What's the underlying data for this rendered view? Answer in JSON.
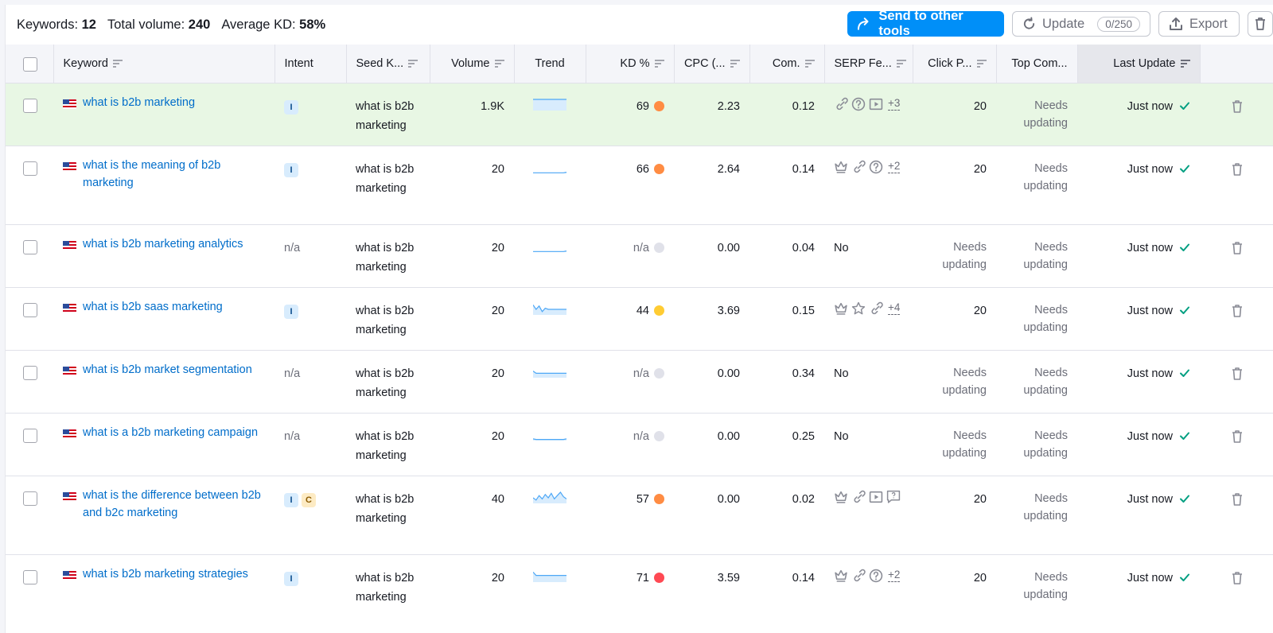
{
  "summary": {
    "keywords_label": "Keywords:",
    "keywords_value": "12",
    "volume_label": "Total volume:",
    "volume_value": "240",
    "kd_label": "Average KD:",
    "kd_value": "58%"
  },
  "toolbar": {
    "send_label": "Send to other tools",
    "update_label": "Update",
    "update_counter": "0/250",
    "export_label": "Export"
  },
  "columns": {
    "keyword": "Keyword",
    "intent": "Intent",
    "seed": "Seed K...",
    "volume": "Volume",
    "trend": "Trend",
    "kd": "KD %",
    "cpc": "CPC (...",
    "com": "Com.",
    "serp": "SERP Fe...",
    "click": "Click P...",
    "top": "Top Com...",
    "last": "Last Update"
  },
  "colors": {
    "accent": "#008ff8",
    "link": "#006dca",
    "kd_orange": "#ff8c43",
    "kd_yellow": "#ffcc33",
    "kd_red": "#ff4953",
    "kd_na": "#e0e1e9",
    "highlight_row": "#e8f7e4"
  },
  "rows": [
    {
      "keyword": "what is b2b marketing",
      "intents": [
        "I"
      ],
      "intent_text": "",
      "seed": "what is b2b marketing",
      "volume": "1.9K",
      "trend": [
        1,
        1,
        1,
        1,
        1,
        1,
        1,
        1,
        1,
        1,
        1,
        1
      ],
      "kd": "69",
      "kd_level": "orange",
      "cpc": "2.23",
      "com": "0.12",
      "serp_icons": [
        "link-icon",
        "question-icon",
        "video-icon"
      ],
      "serp_more": "+3",
      "serp_text": "",
      "click": "20",
      "top": "Needs updating",
      "last": "Just now"
    },
    {
      "keyword": "what is the meaning of b2b marketing",
      "intents": [
        "I"
      ],
      "intent_text": "",
      "seed": "what is b2b marketing",
      "volume": "20",
      "trend": [
        0.05,
        0.05,
        0.05,
        0.05,
        0.05,
        0.05,
        0.05,
        0.05,
        0.05,
        0.05,
        0.05,
        0.1
      ],
      "kd": "66",
      "kd_level": "orange",
      "cpc": "2.64",
      "com": "0.14",
      "serp_icons": [
        "crown-icon",
        "link-icon",
        "question-icon"
      ],
      "serp_more": "+2",
      "serp_text": "",
      "click": "20",
      "top": "Needs updating",
      "last": "Just now"
    },
    {
      "keyword": "what is b2b marketing analytics",
      "intents": [],
      "intent_text": "n/a",
      "seed": "what is b2b marketing",
      "volume": "20",
      "trend": [
        0.05,
        0.05,
        0.05,
        0.05,
        0.05,
        0.05,
        0.05,
        0.05,
        0.05,
        0.05,
        0.05,
        0.1
      ],
      "kd": "n/a",
      "kd_level": "na",
      "cpc": "0.00",
      "com": "0.04",
      "serp_icons": [],
      "serp_more": "",
      "serp_text": "No",
      "click": "Needs updating",
      "top": "Needs updating",
      "last": "Just now"
    },
    {
      "keyword": "what is b2b saas marketing",
      "intents": [
        "I"
      ],
      "intent_text": "",
      "seed": "what is b2b marketing",
      "volume": "20",
      "trend": [
        0.9,
        0.5,
        0.8,
        0.3,
        0.6,
        0.5,
        0.5,
        0.5,
        0.5,
        0.5,
        0.5,
        0.5
      ],
      "kd": "44",
      "kd_level": "yellow",
      "cpc": "3.69",
      "com": "0.15",
      "serp_icons": [
        "crown-icon",
        "star-icon",
        "link-icon"
      ],
      "serp_more": "+4",
      "serp_text": "",
      "click": "20",
      "top": "Needs updating",
      "last": "Just now"
    },
    {
      "keyword": "what is b2b market segmentation",
      "intents": [],
      "intent_text": "n/a",
      "seed": "what is b2b marketing",
      "volume": "20",
      "trend": [
        0.6,
        0.4,
        0.4,
        0.4,
        0.4,
        0.4,
        0.4,
        0.4,
        0.4,
        0.4,
        0.4,
        0.4
      ],
      "kd": "n/a",
      "kd_level": "na",
      "cpc": "0.00",
      "com": "0.34",
      "serp_icons": [],
      "serp_more": "",
      "serp_text": "No",
      "click": "Needs updating",
      "top": "Needs updating",
      "last": "Just now"
    },
    {
      "keyword": "what is a b2b marketing campaign",
      "intents": [],
      "intent_text": "n/a",
      "seed": "what is b2b marketing",
      "volume": "20",
      "trend": [
        0.15,
        0.1,
        0.1,
        0.1,
        0.1,
        0.1,
        0.1,
        0.1,
        0.1,
        0.1,
        0.1,
        0.15
      ],
      "kd": "n/a",
      "kd_level": "na",
      "cpc": "0.00",
      "com": "0.25",
      "serp_icons": [],
      "serp_more": "",
      "serp_text": "No",
      "click": "Needs updating",
      "top": "Needs updating",
      "last": "Just now"
    },
    {
      "keyword": "what is the difference between b2b and b2c marketing",
      "intents": [
        "I",
        "C"
      ],
      "intent_text": "",
      "seed": "what is b2b marketing",
      "volume": "40",
      "trend": [
        0.5,
        0.3,
        0.7,
        0.4,
        0.8,
        0.5,
        0.9,
        0.4,
        0.7,
        1.0,
        0.6,
        0.4
      ],
      "kd": "57",
      "kd_level": "orange",
      "cpc": "0.00",
      "com": "0.02",
      "serp_icons": [
        "crown-icon",
        "link-icon",
        "video-icon",
        "review-icon"
      ],
      "serp_more": "",
      "serp_text": "",
      "click": "20",
      "top": "Needs updating",
      "last": "Just now"
    },
    {
      "keyword": "what is b2b marketing strategies",
      "intents": [
        "I"
      ],
      "intent_text": "",
      "seed": "what is b2b marketing",
      "volume": "20",
      "trend": [
        0.9,
        0.6,
        0.6,
        0.6,
        0.6,
        0.6,
        0.6,
        0.6,
        0.6,
        0.6,
        0.6,
        0.6
      ],
      "kd": "71",
      "kd_level": "red",
      "cpc": "3.59",
      "com": "0.14",
      "serp_icons": [
        "crown-icon",
        "link-icon",
        "question-icon"
      ],
      "serp_more": "+2",
      "serp_text": "",
      "click": "20",
      "top": "Needs updating",
      "last": "Just now"
    }
  ]
}
